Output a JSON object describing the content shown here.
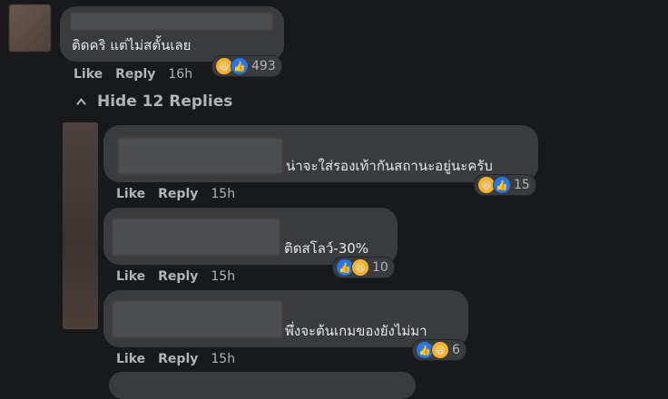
{
  "comment": {
    "text": "ติดคริ แต่ไม่สตั้นเลย",
    "actions": {
      "like": "Like",
      "reply": "Reply",
      "time": "16h"
    },
    "reactions": {
      "count": "493",
      "types": [
        "haha-icon",
        "like-icon"
      ]
    }
  },
  "hide_replies": {
    "label": "Hide 12 Replies"
  },
  "replies": [
    {
      "text": "น่าจะใส่รองเท้ากันสถานะอยู่นะครับ",
      "actions": {
        "like": "Like",
        "reply": "Reply",
        "time": "15h"
      },
      "reactions": {
        "count": "15",
        "types": [
          "haha-icon",
          "like-icon"
        ]
      }
    },
    {
      "text": "ติดสโลว์-30%",
      "actions": {
        "like": "Like",
        "reply": "Reply",
        "time": "15h"
      },
      "reactions": {
        "count": "10",
        "types": [
          "like-icon",
          "haha-icon"
        ]
      }
    },
    {
      "text": "พึ่งจะต้นเกมของยังไม่มา",
      "actions": {
        "like": "Like",
        "reply": "Reply",
        "time": "15h"
      },
      "reactions": {
        "count": "6",
        "types": [
          "like-icon",
          "haha-icon"
        ]
      }
    }
  ],
  "colors": {
    "background": "#18191a",
    "bubble": "#3a3b3c",
    "text": "#e4e6eb",
    "muted": "#b0b3b8",
    "like": "#2078f4",
    "haha": "#f7b125"
  }
}
